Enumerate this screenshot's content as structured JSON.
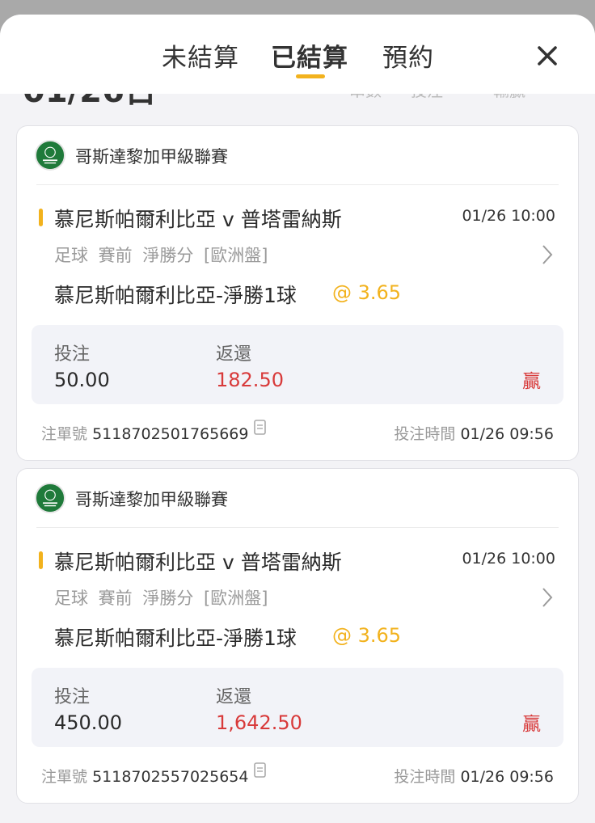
{
  "header": {
    "tabs": [
      {
        "label": "未結算",
        "active": false
      },
      {
        "label": "已結算",
        "active": true
      },
      {
        "label": "預約",
        "active": false
      }
    ],
    "accent_color": "#f2b21d"
  },
  "bets": [
    {
      "league": "哥斯達黎加甲級聯賽",
      "match": "慕尼斯帕爾利比亞 v 普塔雷納斯",
      "match_time": "01/26 10:00",
      "description": "足球 賽前 淨勝分 [歐洲盤]",
      "selection": "慕尼斯帕爾利比亞-淨勝1球",
      "odds": "@ 3.65",
      "stake_label": "投注",
      "stake": "50.00",
      "return_label": "返還",
      "return": "182.50",
      "result": "贏",
      "ticket_label": "注單號",
      "ticket_no": "5118702501765669",
      "time_label": "投注時間",
      "bet_time": "01/26 09:56"
    },
    {
      "league": "哥斯達黎加甲級聯賽",
      "match": "慕尼斯帕爾利比亞 v 普塔雷納斯",
      "match_time": "01/26 10:00",
      "description": "足球 賽前 淨勝分 [歐洲盤]",
      "selection": "慕尼斯帕爾利比亞-淨勝1球",
      "odds": "@ 3.65",
      "stake_label": "投注",
      "stake": "450.00",
      "return_label": "返還",
      "return": "1,642.50",
      "result": "贏",
      "ticket_label": "注單號",
      "ticket_no": "5118702557025654",
      "time_label": "投注時間",
      "bet_time": "01/26 09:56"
    }
  ]
}
